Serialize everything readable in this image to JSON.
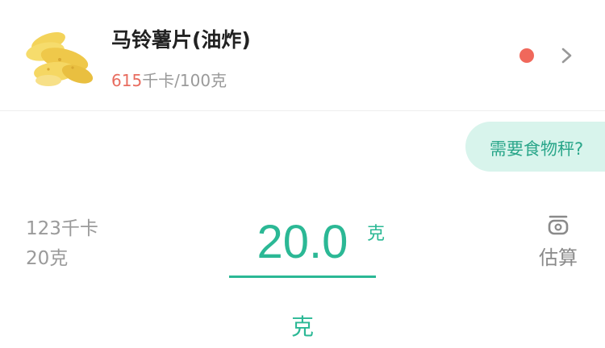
{
  "food": {
    "name": "马铃薯片(油炸)",
    "calories_value": "615",
    "calories_unit": "千卡/100克",
    "image_icon": "potato-chips-image",
    "status_color": "#f0685b"
  },
  "scale_prompt": {
    "label": "需要食物秤?"
  },
  "summary": {
    "calories": "123千卡",
    "weight": "20克"
  },
  "input": {
    "value": "20.0",
    "unit": "克"
  },
  "estimate": {
    "label": "估算",
    "icon": "scale-icon"
  },
  "unit_selector": {
    "selected": "克"
  },
  "colors": {
    "accent": "#2bb895",
    "calorie_number": "#e86c5f",
    "pill_bg": "#d8f4ec"
  }
}
